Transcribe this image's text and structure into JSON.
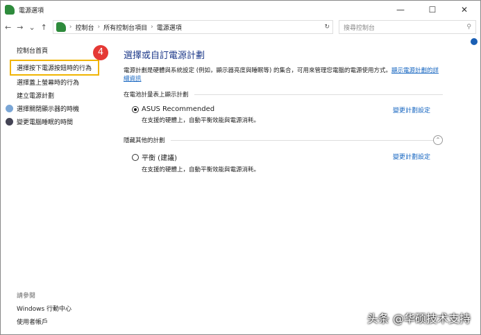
{
  "window": {
    "title": "電源選項",
    "minimize": "—",
    "maximize": "☐",
    "close": "✕"
  },
  "nav": {
    "back": "←",
    "forward": "→",
    "recent": "⌄",
    "up": "↑",
    "breadcrumb": [
      "控制台",
      "所有控制台項目",
      "電源選項"
    ],
    "refresh": "↻",
    "search_placeholder": "搜尋控制台",
    "search_icon": "⚲"
  },
  "sidebar": {
    "home": "控制台首頁",
    "items": [
      {
        "label": "選擇按下電源按鈕時的行為",
        "highlighted": true
      },
      {
        "label": "選擇蓋上螢幕時的行為"
      },
      {
        "label": "建立電源計劃"
      },
      {
        "label": "選擇關閉顯示器的時機",
        "icon": "monitor-icon"
      },
      {
        "label": "變更電腦睡眠的時間",
        "icon": "moon-icon"
      }
    ],
    "step_badge": "4",
    "see_also": {
      "heading": "請參閱",
      "links": [
        "Windows 行動中心",
        "使用者帳戶"
      ]
    }
  },
  "main": {
    "title": "選擇或自訂電源計劃",
    "description": "電源計劃是硬體與系統設定 (例如，顯示器亮度與睡眠等) 的集合，可用來管理您電腦的電源使用方式。",
    "details_link": "顯示電源計劃的詳細資訊",
    "group1": "在電池計量表上顯示計劃",
    "plan1": {
      "name": "ASUS Recommended",
      "desc": "在支援的硬體上，自動平衡效能與電源消耗。",
      "change": "變更計劃設定",
      "selected": true
    },
    "group2": "隱藏其他的計劃",
    "plan2": {
      "name": "平衡 (建議)",
      "desc": "在支援的硬體上，自動平衡效能與電源消耗。",
      "change": "變更計劃設定",
      "selected": false
    }
  },
  "watermark": "头条 @华硕技术支持",
  "colors": {
    "highlight": "#f0b400",
    "badge": "#e53935",
    "link": "#1565c0",
    "title": "#1e3a8a"
  }
}
